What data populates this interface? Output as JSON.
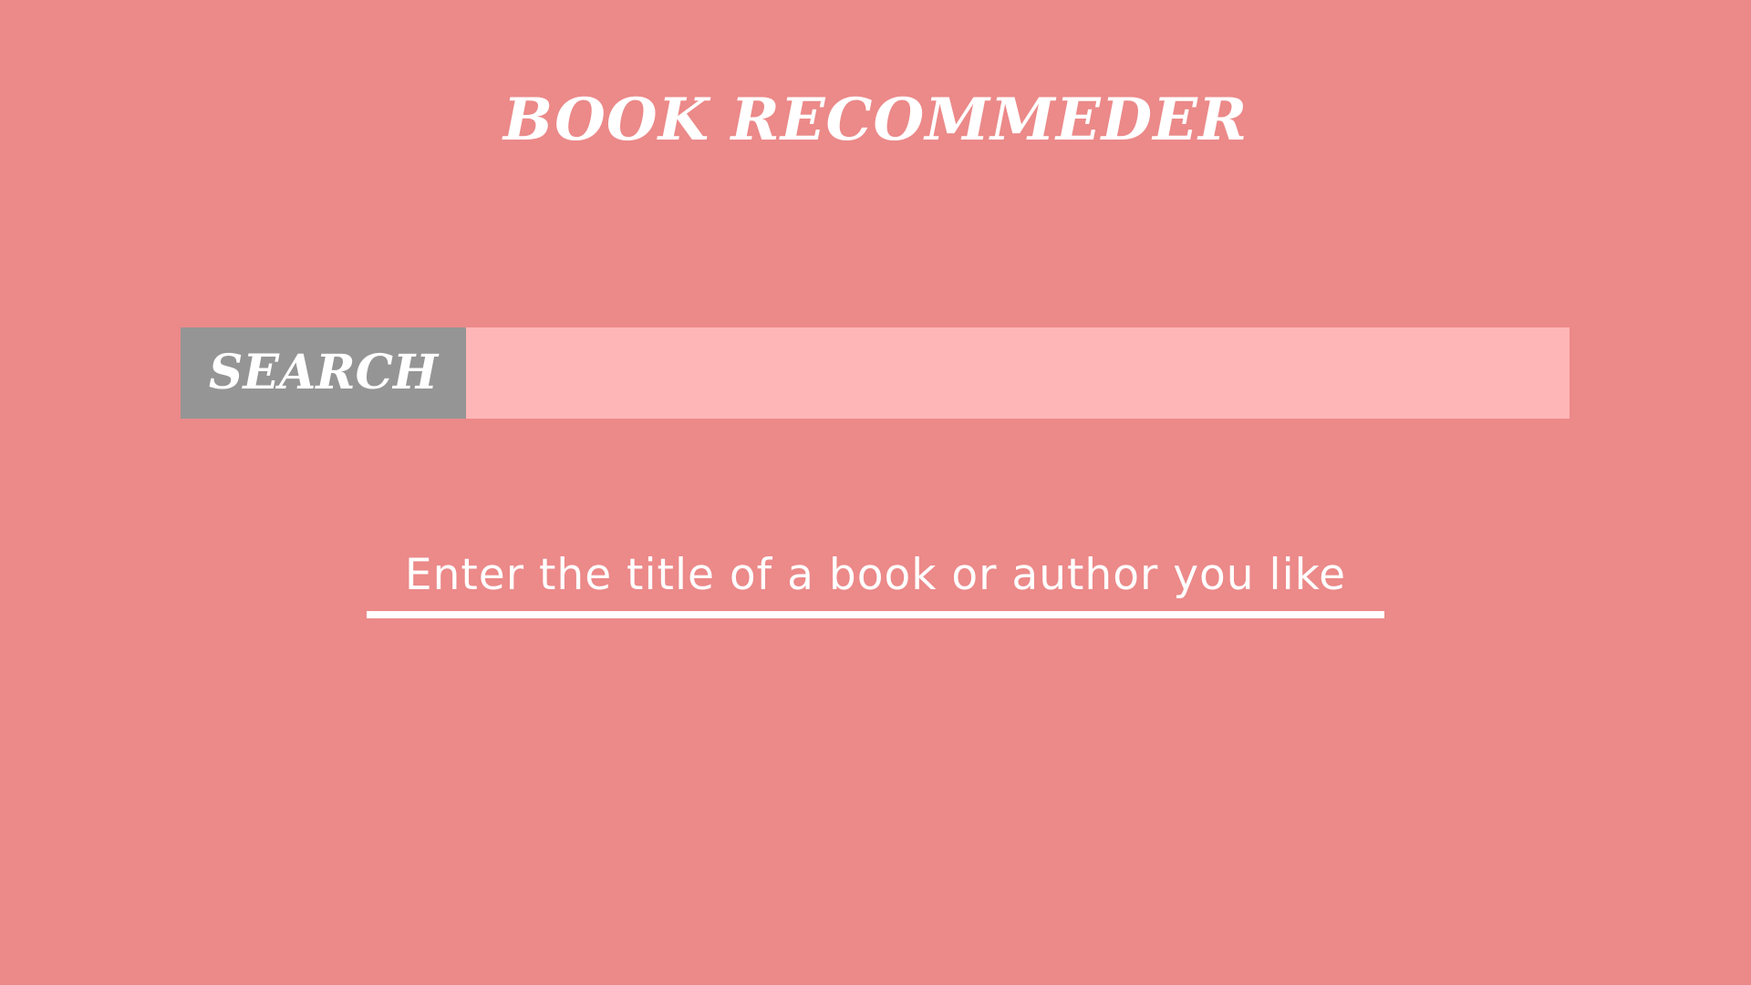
{
  "app": {
    "title": "BOOK RECOMMEDER"
  },
  "search": {
    "button_label": "SEARCH",
    "input_value": "",
    "hint": "Enter the title of a book or author you like"
  },
  "colors": {
    "background": "#EC8989",
    "button": "#959595",
    "input": "#FFB6B6",
    "text": "#FFFFFF"
  }
}
